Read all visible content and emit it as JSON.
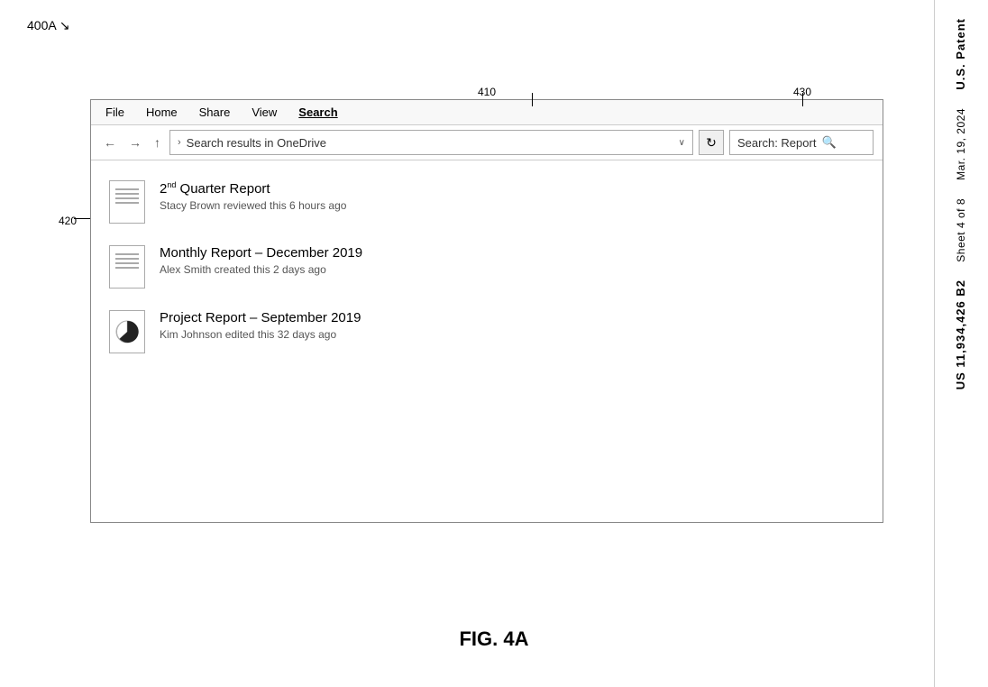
{
  "label_400a": "400A",
  "arrow_400a": "↘",
  "menu": {
    "items": [
      {
        "label": "File",
        "active": false
      },
      {
        "label": "Home",
        "active": false
      },
      {
        "label": "Share",
        "active": false
      },
      {
        "label": "View",
        "active": false
      },
      {
        "label": "Search",
        "active": true
      }
    ]
  },
  "toolbar": {
    "back": "←",
    "forward": "→",
    "up": "↑",
    "chevron": ">",
    "address_text": "Search results in OneDrive",
    "dropdown": "∨",
    "refresh": "↻",
    "search_label": "Search: Report",
    "search_icon": "🔍"
  },
  "label_410": "410",
  "label_430": "430",
  "label_420": "420",
  "files": [
    {
      "name_html": "2nd Quarter Report",
      "superscript": "nd",
      "name_prefix": "2",
      "name_suffix": " Quarter Report",
      "meta": "Stacy Brown reviewed this 6 hours ago",
      "type": "text"
    },
    {
      "name": "Monthly Report – December 2019",
      "meta": "Alex Smith created this 2 days ago",
      "type": "text"
    },
    {
      "name": "Project Report – September 2019",
      "meta": "Kim Johnson edited this 32 days ago",
      "type": "chart"
    }
  ],
  "figure_caption": "FIG. 4A",
  "patent": {
    "line1": "U.S. Patent",
    "line2": "Mar. 19, 2024",
    "line3": "Sheet 4 of 8",
    "line4": "US 11,934,426 B2"
  }
}
